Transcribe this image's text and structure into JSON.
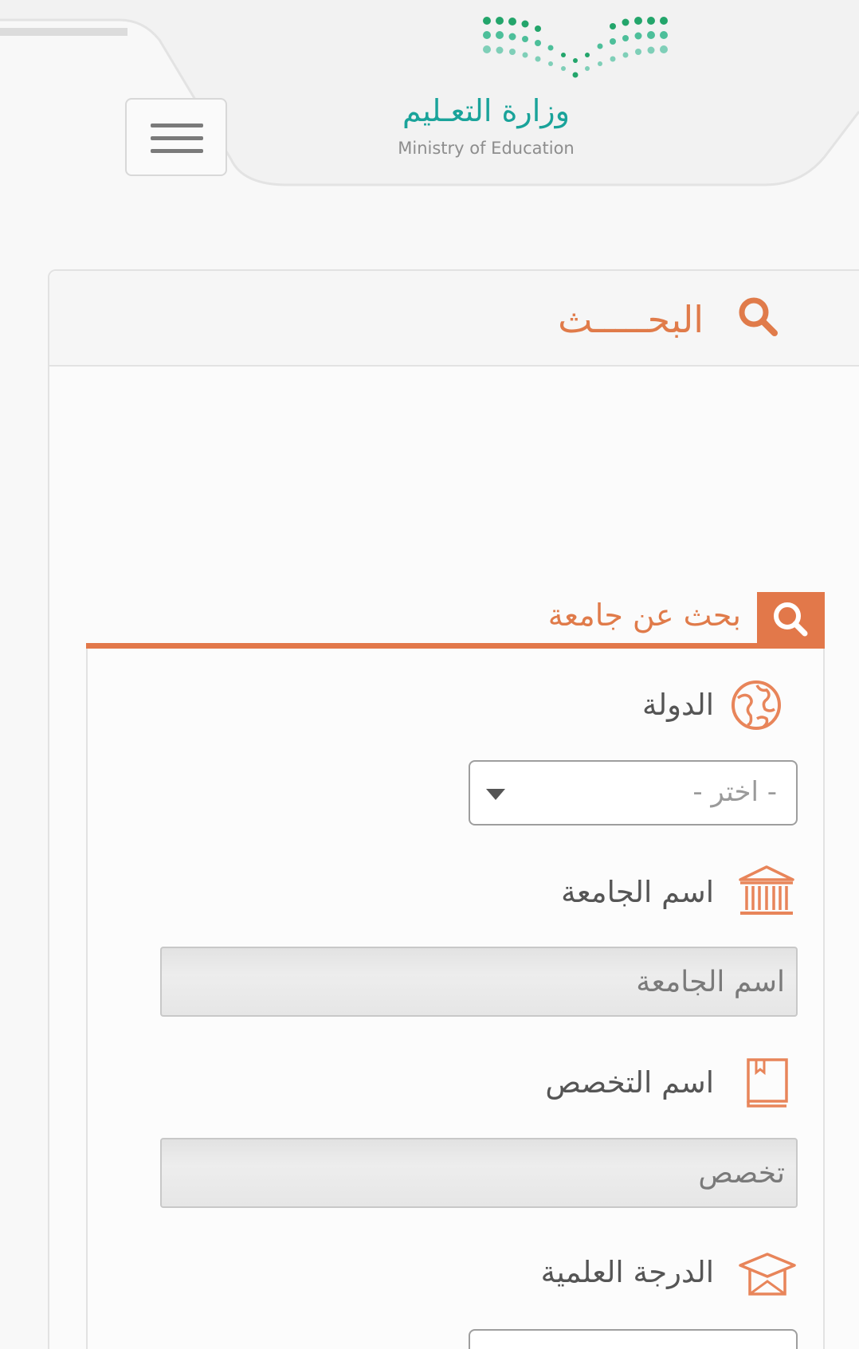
{
  "header": {
    "logo_ar": "وزارة التعـليم",
    "logo_en": "Ministry of Education",
    "menu_label": ""
  },
  "search_panel": {
    "title": "البحـــــث"
  },
  "tab": {
    "label": "بحث عن جامعة"
  },
  "fields": {
    "country": {
      "label": "الدولة",
      "selected": "- اختر -"
    },
    "university": {
      "label": "اسم الجامعة",
      "placeholder": "اسم الجامعة"
    },
    "major": {
      "label": "اسم التخصص",
      "placeholder": "تخصص"
    },
    "degree": {
      "label": "الدرجة العلمية"
    }
  },
  "colors": {
    "accent": "#e2784a",
    "logo_teal": "#1aa39a",
    "logo_green": "#23a56b"
  },
  "icons": [
    "menu-icon",
    "search-icon",
    "globe-icon",
    "university-icon",
    "book-icon",
    "graduation-cap-icon",
    "caret-down-icon"
  ]
}
